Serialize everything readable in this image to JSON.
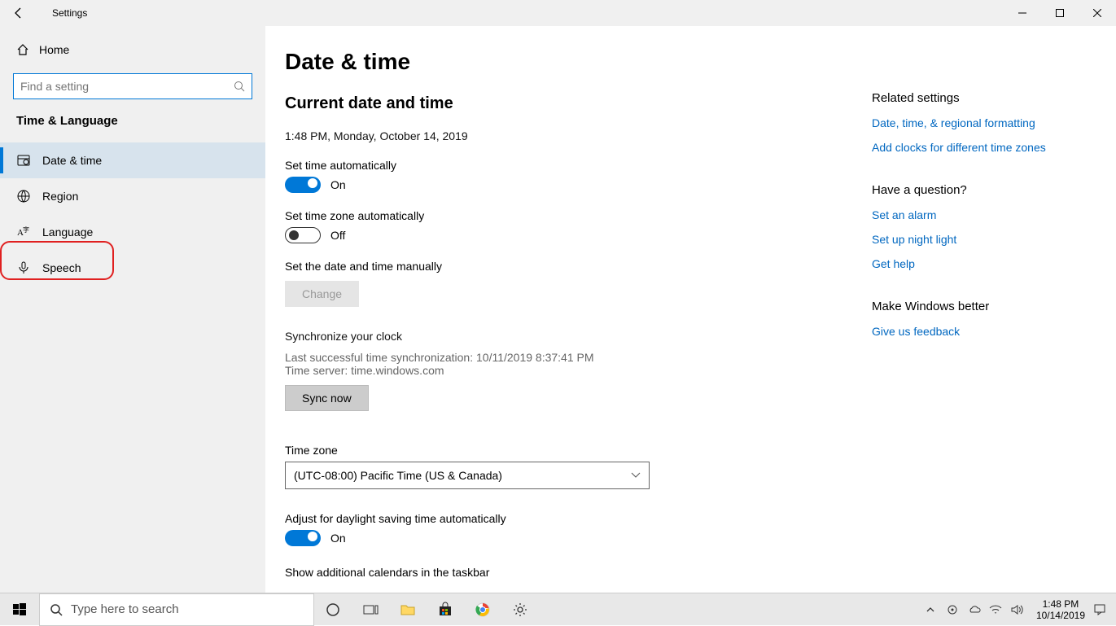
{
  "titlebar": {
    "title": "Settings"
  },
  "sidebar": {
    "home": "Home",
    "search_placeholder": "Find a setting",
    "section": "Time & Language",
    "items": [
      {
        "label": "Date & time"
      },
      {
        "label": "Region"
      },
      {
        "label": "Language"
      },
      {
        "label": "Speech"
      }
    ]
  },
  "main": {
    "title": "Date & time",
    "section1": "Current date and time",
    "now": "1:48 PM, Monday, October 14, 2019",
    "set_time_auto": {
      "label": "Set time automatically",
      "state": "On"
    },
    "set_tz_auto": {
      "label": "Set time zone automatically",
      "state": "Off"
    },
    "set_manual": {
      "label": "Set the date and time manually",
      "button": "Change"
    },
    "sync": {
      "title": "Synchronize your clock",
      "last": "Last successful time synchronization: 10/11/2019 8:37:41 PM",
      "server": "Time server: time.windows.com",
      "button": "Sync now"
    },
    "timezone": {
      "label": "Time zone",
      "value": "(UTC-08:00) Pacific Time (US & Canada)"
    },
    "dst": {
      "label": "Adjust for daylight saving time automatically",
      "state": "On"
    },
    "extra_cal": "Show additional calendars in the taskbar"
  },
  "right": {
    "related_h": "Related settings",
    "related": [
      "Date, time, & regional formatting",
      "Add clocks for different time zones"
    ],
    "question_h": "Have a question?",
    "question": [
      "Set an alarm",
      "Set up night light",
      "Get help"
    ],
    "feedback_h": "Make Windows better",
    "feedback": [
      "Give us feedback"
    ]
  },
  "taskbar": {
    "search": "Type here to search",
    "time": "1:48 PM",
    "date": "10/14/2019"
  }
}
